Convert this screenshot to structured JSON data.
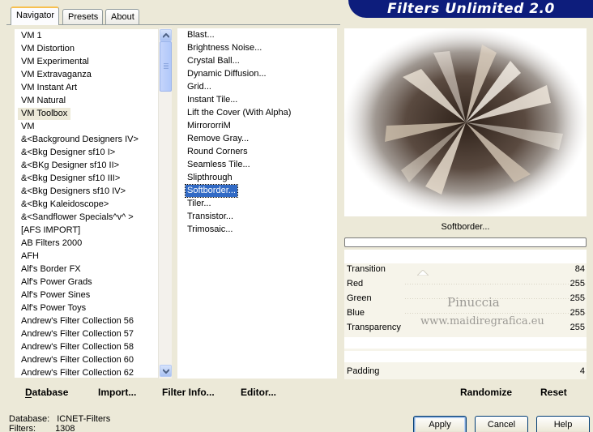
{
  "tabs": [
    {
      "label": "Navigator",
      "active": true
    },
    {
      "label": "Presets",
      "active": false
    },
    {
      "label": "About",
      "active": false
    }
  ],
  "header": {
    "title": "Filters Unlimited 2.0",
    "color": "#0d1d7c"
  },
  "categories": {
    "items": [
      "VM 1",
      "VM Distortion",
      "VM Experimental",
      "VM Extravaganza",
      "VM Instant Art",
      "VM Natural",
      "VM Toolbox",
      "VM",
      "&<Background Designers IV>",
      "&<Bkg Designer sf10 I>",
      "&<BKg Designer sf10 II>",
      "&<Bkg Designer sf10 III>",
      "&<Bkg Designers sf10 IV>",
      "&<Bkg Kaleidoscope>",
      "&<Sandflower Specials^v^ >",
      "[AFS IMPORT]",
      "AB Filters 2000",
      "AFH",
      "Alf's Border FX",
      "Alf's Power Grads",
      "Alf's Power Sines",
      "Alf's Power Toys",
      "Andrew's Filter Collection 56",
      "Andrew's Filter Collection 57",
      "Andrew's Filter Collection 58",
      "Andrew's Filter Collection 60",
      "Andrew's Filter Collection 62"
    ],
    "selected_index": 6
  },
  "filters": {
    "items": [
      "Blast...",
      "Brightness Noise...",
      "Crystal Ball...",
      "Dynamic Diffusion...",
      "Grid...",
      "Instant Tile...",
      "Lift the Cover (With Alpha)",
      "MirrororriM",
      "Remove Gray...",
      "Round Corners",
      "Seamless Tile...",
      "Slipthrough",
      "Softborder...",
      "Tiler...",
      "Transistor...",
      "Trimosaic..."
    ],
    "selected_index": 12
  },
  "preview": {
    "filter_name": "Softborder..."
  },
  "params": [
    {
      "label": "Transition",
      "value": "84"
    },
    {
      "label": "Red",
      "value": "255"
    },
    {
      "label": "Green",
      "value": "255"
    },
    {
      "label": "Blue",
      "value": "255"
    },
    {
      "label": "Transparency",
      "value": "255"
    }
  ],
  "padding": {
    "label": "Padding",
    "value": "4"
  },
  "watermark": {
    "line1": "Pinuccia",
    "line2": "www.maidiregrafica.eu"
  },
  "actions": {
    "database": "Database",
    "import": "Import...",
    "filter_info": "Filter Info...",
    "editor": "Editor...",
    "randomize": "Randomize",
    "reset": "Reset"
  },
  "db_info": {
    "database_label": "Database:",
    "database_value": "ICNET-Filters",
    "filters_label": "Filters:",
    "filters_value": "1308"
  },
  "buttons": {
    "apply": "Apply",
    "cancel": "Cancel",
    "help": "Help"
  },
  "colors": {
    "selection": "#316ac5",
    "face": "#ece9d8"
  }
}
